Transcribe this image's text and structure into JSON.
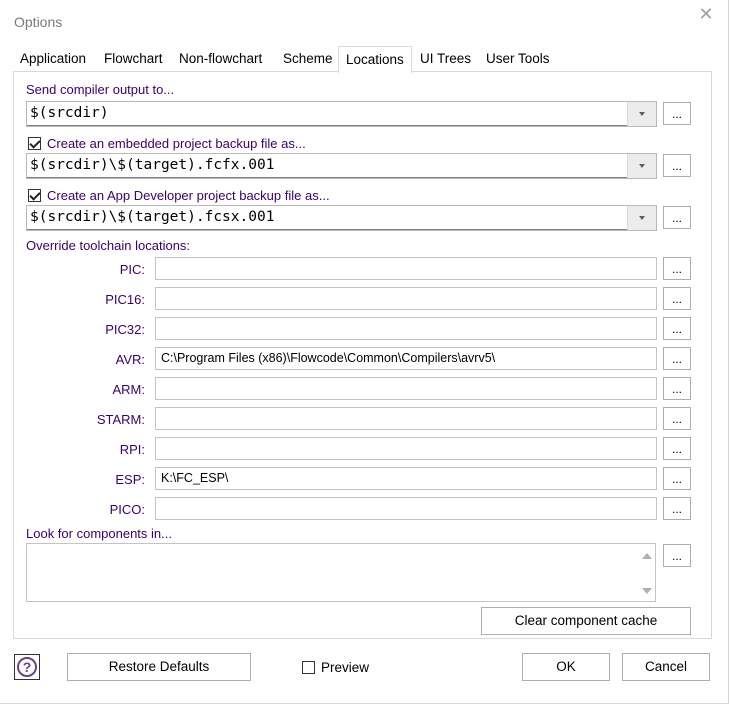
{
  "window": {
    "title": "Options",
    "close_glyph": "✕"
  },
  "tabs": [
    {
      "label": "Application"
    },
    {
      "label": "Flowchart"
    },
    {
      "label": "Non-flowchart"
    },
    {
      "label": "Scheme"
    },
    {
      "label": "Locations"
    },
    {
      "label": "UI Trees"
    },
    {
      "label": "User Tools"
    }
  ],
  "active_tab": "Locations",
  "compiler_output": {
    "label": "Send compiler output to...",
    "value": "$(srcdir)"
  },
  "embedded_backup": {
    "label": "Create an embedded project backup file as...",
    "checked": true,
    "value": "$(srcdir)\\$(target).fcfx.001"
  },
  "appdev_backup": {
    "label": "Create an App Developer project backup file as...",
    "checked": true,
    "value": "$(srcdir)\\$(target).fcsx.001"
  },
  "browse_label": "...",
  "toolchain": {
    "heading": "Override toolchain locations:",
    "items": [
      {
        "label": "PIC:",
        "value": ""
      },
      {
        "label": "PIC16:",
        "value": ""
      },
      {
        "label": "PIC32:",
        "value": ""
      },
      {
        "label": "AVR:",
        "value": "C:\\Program Files (x86)\\Flowcode\\Common\\Compilers\\avrv5\\"
      },
      {
        "label": "ARM:",
        "value": ""
      },
      {
        "label": "STARM:",
        "value": ""
      },
      {
        "label": "RPI:",
        "value": ""
      },
      {
        "label": "ESP:",
        "value": "K:\\FC_ESP\\"
      },
      {
        "label": "PICO:",
        "value": ""
      }
    ]
  },
  "components": {
    "label": "Look for components in...",
    "clear_cache_label": "Clear component cache"
  },
  "footer": {
    "help_glyph": "?",
    "restore_label": "Restore Defaults",
    "preview_label": "Preview",
    "preview_checked": false,
    "ok_label": "OK",
    "cancel_label": "Cancel"
  },
  "colors": {
    "label_purple": "#3a006e",
    "border": "#d9d9d9",
    "help_purple": "#6a3f8f"
  }
}
